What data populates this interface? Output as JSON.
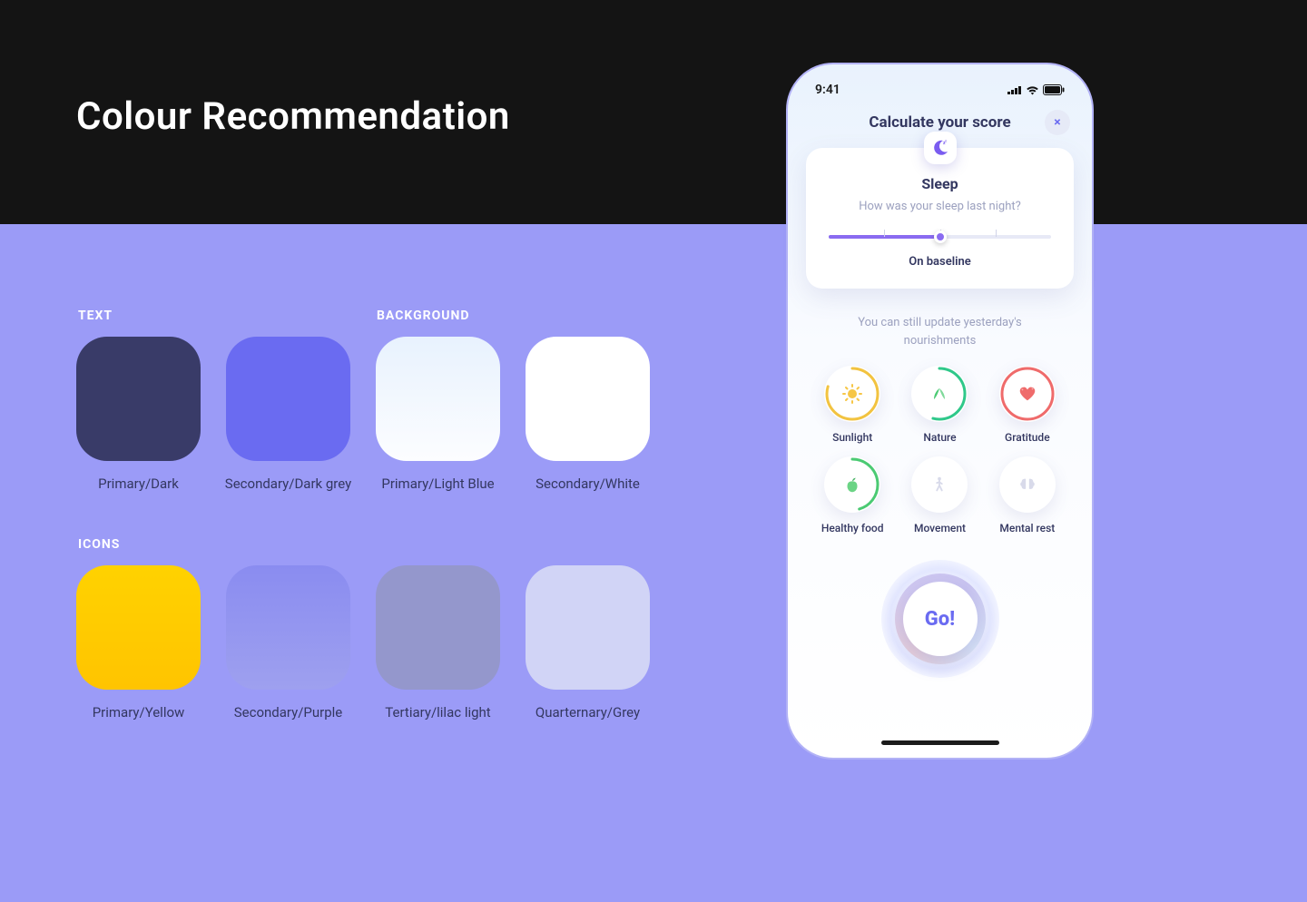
{
  "page": {
    "title": "Colour Recommendation"
  },
  "sections": {
    "text": "TEXT",
    "background": "BACKGROUND",
    "icons": "ICONS"
  },
  "swatches_row1": [
    {
      "label": "Primary/Dark"
    },
    {
      "label": "Secondary/Dark grey"
    },
    {
      "label": "Primary/Light Blue"
    },
    {
      "label": "Secondary/White"
    }
  ],
  "swatches_row2": [
    {
      "label": "Primary/Yellow"
    },
    {
      "label": "Secondary/Purple"
    },
    {
      "label": "Tertiary/lilac light"
    },
    {
      "label": "Quarternary/Grey"
    }
  ],
  "phone": {
    "status_time": "9:41",
    "header": "Calculate your score",
    "close": "×",
    "card": {
      "title": "Sleep",
      "subtitle": "How was your sleep last night?",
      "slider_label": "On baseline"
    },
    "hint": "You can still update yesterday's nourishments",
    "chips": [
      {
        "label": "Sunlight"
      },
      {
        "label": "Nature"
      },
      {
        "label": "Gratitude"
      },
      {
        "label": "Healthy food"
      },
      {
        "label": "Movement"
      },
      {
        "label": "Mental rest"
      }
    ],
    "go": "Go!"
  }
}
